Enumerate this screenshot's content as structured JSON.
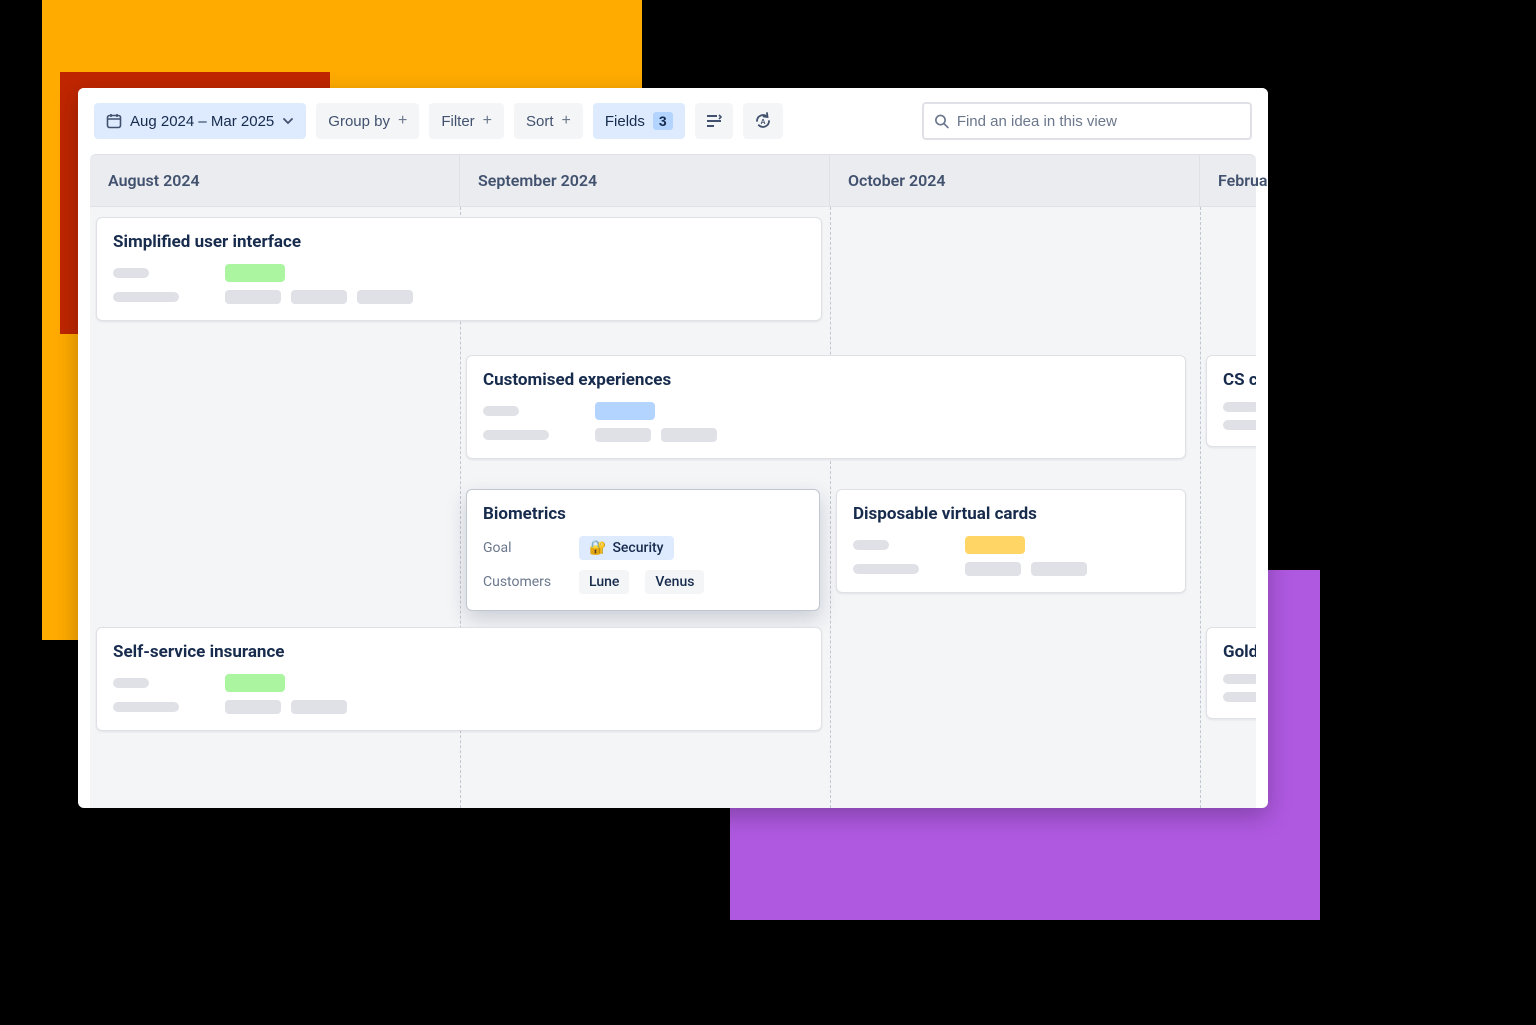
{
  "toolbar": {
    "date_range": "Aug 2024 – Mar 2025",
    "group_by": "Group by",
    "filter": "Filter",
    "sort": "Sort",
    "fields": "Fields",
    "fields_count": "3",
    "search_placeholder": "Find an idea in this view"
  },
  "timeline": {
    "months": [
      "August 2024",
      "September 2024",
      "October 2024",
      "February"
    ]
  },
  "cards": {
    "simplified": {
      "title": "Simplified user interface"
    },
    "customised": {
      "title": "Customised experiences"
    },
    "cs": {
      "title": "CS ch"
    },
    "biometrics": {
      "title": "Biometrics",
      "goal_label": "Goal",
      "goal_value": "Security",
      "customers_label": "Customers",
      "customer1": "Lune",
      "customer2": "Venus"
    },
    "disposable": {
      "title": "Disposable virtual cards"
    },
    "selfservice": {
      "title": "Self-service insurance"
    },
    "gold": {
      "title": "Gold"
    }
  }
}
